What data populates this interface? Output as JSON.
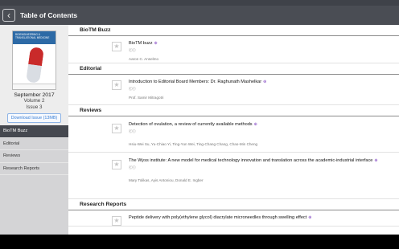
{
  "app": {
    "title": "Table of Contents",
    "back_icon": "chevron-left-icon"
  },
  "cover": {
    "journal_title": "BIOENGINEERING & TRANSLATIONAL MEDICINE",
    "date": "September 2017",
    "volume": "Volume 2",
    "issue": "Issue 3",
    "download_label": "Download Issue (13MB)"
  },
  "nav": {
    "items": [
      {
        "label": "BioTM Buzz",
        "active": true
      },
      {
        "label": "Editorial",
        "active": false
      },
      {
        "label": "Reviews",
        "active": false
      },
      {
        "label": "Research Reports",
        "active": false
      }
    ]
  },
  "sections": [
    {
      "title": "BioTM Buzz",
      "articles": [
        {
          "title": "BioTM buzz",
          "authors": "Aaron C. Anselmo"
        }
      ]
    },
    {
      "title": "Editorial",
      "articles": [
        {
          "title": "Introduction to Editorial Board Members: Dr. Raghunath Mashelkar",
          "authors": "Prof. Samir Mitragotri"
        }
      ]
    },
    {
      "title": "Reviews",
      "articles": [
        {
          "title": "Detection of ovulation, a review of currently available methods",
          "authors": "Hsiu-Wei Su, Yu-Chiao Yi, Ting-Yun Wei, Ting-Chang Chang, Chao-Min Cheng"
        },
        {
          "title": "The Wyss institute: A new model for medical technology innovation and translation across the academic-industrial interface",
          "authors": "Mary Tolikas, Ayis Antoniou, Donald E. Ingber"
        }
      ]
    },
    {
      "title": "Research Reports",
      "articles": [
        {
          "title": "Peptide delivery with poly(ethylene glycol) diacrylate microneedles through swelling effect",
          "authors": ""
        }
      ]
    }
  ],
  "icons": {
    "star": "star-icon",
    "lock": "open-lock-icon",
    "open_access": "open-access-license-icon"
  },
  "colors": {
    "appbar": "#4a4d54",
    "active_nav": "#45484f",
    "link": "#3a7fd5",
    "lock": "#7d3fc0"
  },
  "open_access_glyph": "ⓒⓘ"
}
